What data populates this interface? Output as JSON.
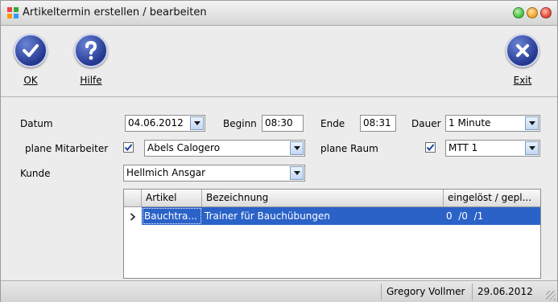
{
  "window": {
    "title": "Artikeltermin erstellen / bearbeiten",
    "icon": "app-grid-icon",
    "colors": {
      "minimize": "#3fbf3f",
      "maximize": "#f0a020",
      "close": "#e04030"
    }
  },
  "toolbar": {
    "ok_label": "OK",
    "help_label": "Hilfe",
    "exit_label": "Exit"
  },
  "form": {
    "datum_label": "Datum",
    "datum_value": "04.06.2012",
    "beginn_label": "Beginn",
    "beginn_value": "08:30",
    "ende_label": "Ende",
    "ende_value": "08:31",
    "dauer_label": "Dauer",
    "dauer_value": "1 Minute",
    "plane_mitarbeiter_label": "plane Mitarbeiter",
    "plane_mitarbeiter_checked": true,
    "mitarbeiter_value": "Abels Calogero",
    "plane_raum_label": "plane Raum",
    "plane_raum_checked": true,
    "raum_value": "MTT 1",
    "kunde_label": "Kunde",
    "kunde_value": "Hellmich Ansgar"
  },
  "grid": {
    "columns": [
      "Artikel",
      "Bezeichnung",
      "eingelöst / gepl..."
    ],
    "rows": [
      {
        "artikel": "Bauchtra...",
        "bezeichnung": "Trainer für Bauchübungen",
        "eingeloest": "0  /0  /1",
        "selected": true
      }
    ],
    "selection_color": "#2a62c8"
  },
  "status": {
    "user": "Gregory Vollmer",
    "date": "29.06.2012"
  }
}
